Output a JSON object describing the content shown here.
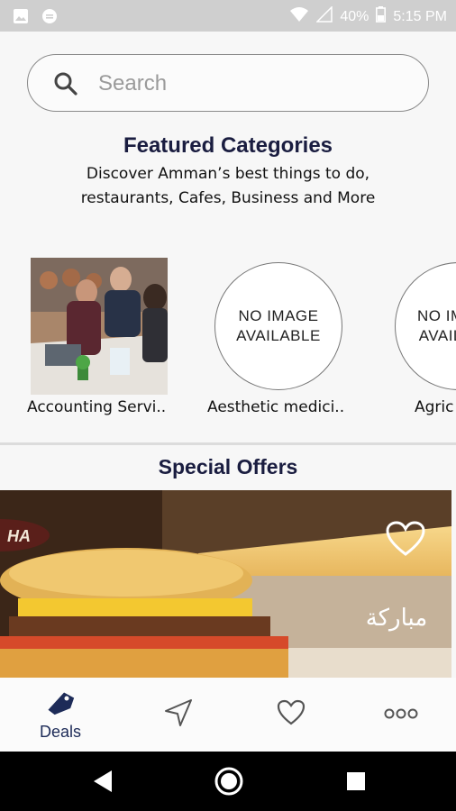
{
  "status": {
    "battery": "40%",
    "time": "5:15 PM"
  },
  "search": {
    "placeholder": "Search",
    "value": ""
  },
  "featured": {
    "title": "Featured Categories",
    "subtitle_line1": "Discover Amman’s best things to do,",
    "subtitle_line2": "restaurants, Cafes, Business and More"
  },
  "categories": [
    {
      "label": "Accounting Servi..",
      "image": "photo"
    },
    {
      "label": "Aesthetic medici..",
      "image_text_1": "NO IMAGE",
      "image_text_2": "AVAILABLE"
    },
    {
      "label": "Agric",
      "image_text_1": "NO IM",
      "image_text_2": "AVAIL"
    }
  ],
  "offers": {
    "title": "Special Offers",
    "banner_arabic": "مباركة"
  },
  "nav": {
    "deals_label": "Deals",
    "items": [
      "deals",
      "nearby",
      "favorites",
      "more"
    ]
  },
  "colors": {
    "title": "#1a1d40",
    "nav_active": "#1d2b58"
  }
}
